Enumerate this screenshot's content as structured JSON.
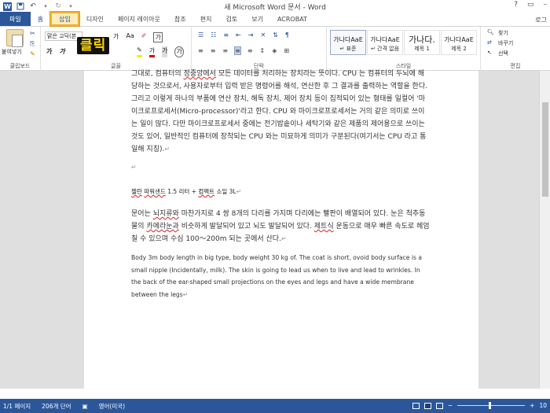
{
  "window": {
    "title": "새 Microsoft Word 문서 - Word",
    "help": "?",
    "controls": [
      "–",
      "□",
      "✕"
    ]
  },
  "qat": {
    "logo": "W"
  },
  "tabs": {
    "file": "파일",
    "home": "홈",
    "insert": "삽입",
    "design": "디자인",
    "layout": "페이지 레이아웃",
    "references": "참조",
    "mailings": "편지",
    "review": "검토",
    "view": "보기",
    "acrobat": "ACROBAT",
    "login": "로그"
  },
  "ribbon": {
    "clipboard": {
      "label": "클립보드",
      "paste": "붙여넣기"
    },
    "font": {
      "label": "글꼴",
      "font_name": "맑은 고딕(본",
      "grow": "가",
      "change_case": "Aa",
      "clear": "가"
    },
    "paragraph": {
      "label": "단락"
    },
    "styles": {
      "label": "스타일",
      "items": [
        {
          "sample": "가나다AaE",
          "name": "↵ 표준"
        },
        {
          "sample": "가나다AaE",
          "name": "↵ 간격 없음"
        },
        {
          "sample": "가나다.",
          "name": "제목 1"
        },
        {
          "sample": "가나다AaE",
          "name": "제목 2"
        }
      ]
    },
    "editing": {
      "label": "편집",
      "find": "찾기",
      "replace": "바꾸기",
      "select": "선택"
    }
  },
  "callout": {
    "text": "클릭"
  },
  "document": {
    "para1": [
      "그대로, 컴퓨터의 ",
      "정중앙에서",
      " 모든 데이터를 처리하는 장치라는 뜻이다. CPU 는 컴퓨터의 두뇌에 해당하는 것으로서, 사용자로부터 입력 받은 명령어를 해석, 연산한 후 그 결과를 출력하는 역할을 한다. 그리고 이렇게 하나의 부품에 연산 장치, 해독 장치, 제어 장치 등이 집적되어 있는 형태를 일컬어 '마이크로프로세서(Micro-processor)'라고 한다. CPU 와 마이크로프로세서는 거의 같은 의미로 쓰이는 일이 많다. 다만 마이크로프로세서 중에는 전기밥솥이나 세탁기와 같은 제품의 제어용으로 쓰이는 것도 있어, 일반적인 컴퓨터에 장착되는 CPU 와는 미묘하게 의미가 구분된다(여기서는 CPU 라고 통일해 지칭)."
    ],
    "blank_mark": "↵",
    "title_line": {
      "a": "젤란",
      "b": " ",
      "c": "파워샌드",
      "d": " 1.5 리터 + ",
      "e": "컴팩트",
      "f": " 소일 3L"
    },
    "para2": {
      "a": "문어는 ",
      "b": "뇌지류와",
      "c": " 마찬가지로 4 쌍 8개의 다리를 가지며 다리에는 빨판이 배열되어 있다. 눈은 척추동물의 ",
      "d": "카메라눈과",
      "e": " 비슷하게 발달되어 있고 뇌도 발달되어 있다. ",
      "f": "제트식",
      "g": " 운동으로 매우 빠른 속도로 헤엄칠 수 있으며 수심 100～200m 되는 곳에서 산다."
    },
    "para3": "Body 3m body length in big type, body weight 30 kg of. The coat is short, ovoid body surface is a small nipple (Incidentally, milk). The skin is going to lead us when to live and lead to wrinkles. In the back of the ear-shaped small projections on the eyes and legs and have a wide membrane between the legs"
  },
  "status": {
    "page": "1/1 페이지",
    "words": "206개 단어",
    "language": "영어(미국)",
    "zoom_minus": "−",
    "zoom_plus": "+",
    "zoom": "10"
  }
}
